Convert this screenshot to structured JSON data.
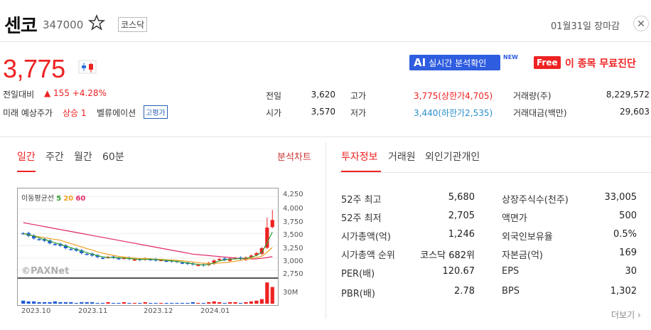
{
  "header": {
    "name": "센코",
    "code": "347000",
    "market": "코스닥",
    "status": "01월31일 장마감"
  },
  "price": {
    "current": "3,775",
    "change_label": "전일대비",
    "change": "▲ 155 +4.28%",
    "forecast_label": "미래 예상주가",
    "forecast_value": "상승 1",
    "valuation_label": "벨류에이션",
    "valuation_badge": "고평가"
  },
  "promo": {
    "ai_logo": "AI",
    "ai_text": "실시간 분석확인",
    "new_tag": "NEW",
    "free_logo": "Free",
    "free_text": "이 종목 무료진단"
  },
  "quote": {
    "prev_close_label": "전일",
    "prev_close": "3,620",
    "open_label": "시가",
    "open": "3,570",
    "high_label": "고가",
    "high": "3,775(상한가4,705)",
    "low_label": "저가",
    "low": "3,440(하한가2,535)",
    "volume_label": "거래량(주)",
    "volume": "8,229,572",
    "amount_label": "거래대금(백만)",
    "amount": "29,603"
  },
  "chart_tabs": [
    "일간",
    "주간",
    "월간",
    "60분"
  ],
  "analysis_link": "분석차트",
  "info_tabs": [
    "투자정보",
    "거래원",
    "외인기관개인"
  ],
  "chart": {
    "ma_title": "이동평균선",
    "ma5": "5",
    "ma20": "20",
    "ma60": "60",
    "ma5_color": "#2e9e2e",
    "ma20_color": "#f0a020",
    "ma60_color": "#e0286a",
    "watermark": "©PAXNet",
    "volume_label": "30M",
    "price_ticks": [
      "4,250",
      "4,000",
      "3,750",
      "3,500",
      "3,250",
      "3,000",
      "2,750"
    ],
    "date_ticks": [
      "2023.10",
      "2023.11",
      "2023.12",
      "2024.01"
    ]
  },
  "chart_data": {
    "type": "candlestick",
    "ylim": [
      2650,
      4300
    ],
    "closes": [
      3500,
      3450,
      3400,
      3380,
      3350,
      3300,
      3280,
      3250,
      3200,
      3180,
      3150,
      3100,
      3080,
      3050,
      3020,
      3000,
      3020,
      3010,
      2990,
      3000,
      2980,
      2970,
      2960,
      2990,
      2970,
      2950,
      2960,
      2940,
      2930,
      2920,
      2900,
      2880,
      2870,
      2860,
      2850,
      2900,
      2950,
      2980,
      2960,
      2990,
      3000,
      2980,
      3010,
      3050,
      3100,
      3200,
      3620,
      3775
    ],
    "ma60": [
      3720,
      3700,
      3680,
      3660,
      3640,
      3620,
      3600,
      3580,
      3560,
      3540,
      3520,
      3500,
      3480,
      3460,
      3440,
      3420,
      3400,
      3380,
      3360,
      3340,
      3320,
      3300,
      3280,
      3260,
      3240,
      3220,
      3200,
      3180,
      3160,
      3140,
      3120,
      3100,
      3080,
      3070,
      3060,
      3050,
      3040,
      3030,
      3020,
      3010,
      3000,
      2990,
      2985,
      2980,
      2985,
      2995,
      3010,
      3030
    ],
    "volumes": [
      4,
      3,
      3,
      2,
      2,
      2,
      3,
      2,
      2,
      2,
      1,
      2,
      2,
      2,
      1,
      1,
      2,
      1,
      1,
      2,
      1,
      1,
      1,
      2,
      1,
      1,
      1,
      1,
      1,
      1,
      1,
      1,
      2,
      1,
      1,
      2,
      3,
      2,
      1,
      2,
      2,
      1,
      2,
      3,
      4,
      6,
      28,
      22
    ]
  },
  "invest": {
    "rows_left": [
      {
        "label": "52주 최고",
        "value": "5,680"
      },
      {
        "label": "52주 최저",
        "value": "2,705"
      },
      {
        "label": "시가총액(억)",
        "value": "1,246"
      },
      {
        "label": "시가총액 순위",
        "value": "코스닥 682위"
      },
      {
        "label": "PER(배)",
        "value": "120.67"
      },
      {
        "label": "PBR(배)",
        "value": "2.78"
      }
    ],
    "rows_right": [
      {
        "label": "상장주식수(천주)",
        "value": "33,005"
      },
      {
        "label": "액면가",
        "value": "500"
      },
      {
        "label": "외국인보유율",
        "value": "0.5%"
      },
      {
        "label": "자본금(억)",
        "value": "169"
      },
      {
        "label": "EPS",
        "value": "30"
      },
      {
        "label": "BPS",
        "value": "1,302"
      }
    ],
    "more": "더보기"
  }
}
